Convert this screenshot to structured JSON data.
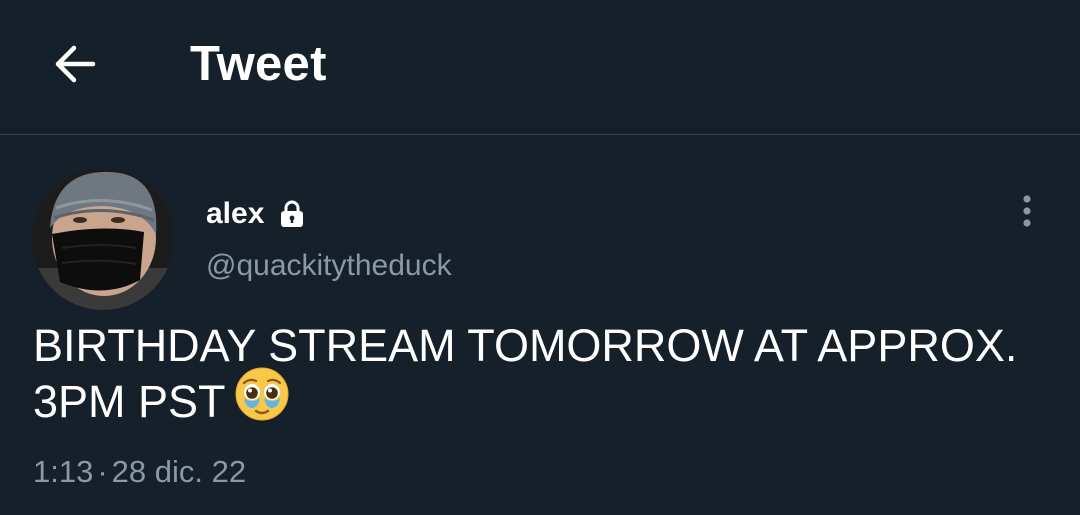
{
  "header": {
    "title": "Tweet",
    "back_icon": "arrow-left-icon"
  },
  "author": {
    "display_name": "alex",
    "handle": "@quackitytheduck",
    "protected_icon": "lock-icon",
    "avatar_icon": "profile-photo"
  },
  "tweet": {
    "text": "BIRTHDAY STREAM TOMORROW AT APPROX. 3PM PST",
    "emoji": "pleading-face-with-tears",
    "time": "1:13",
    "separator": "·",
    "date": "28 dic. 22"
  },
  "menu": {
    "more_icon": "more-vertical-icon"
  },
  "colors": {
    "background": "#15202b",
    "divider": "#38444d",
    "secondary_text": "#8b98a5",
    "primary_text": "#ffffff"
  }
}
